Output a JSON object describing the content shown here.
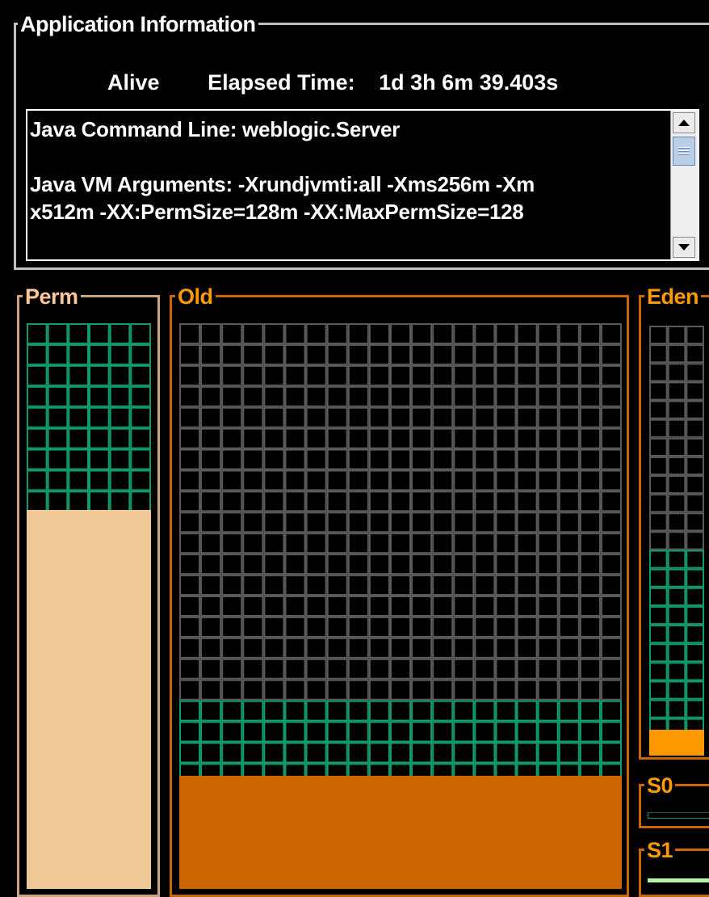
{
  "app_info": {
    "title": "Application Information",
    "status": "Alive",
    "elapsed_label": "Elapsed Time:",
    "elapsed_value": "1d 3h 6m 39.403s",
    "command_lines": [
      "Java Command Line: weblogic.Server",
      "",
      "Java VM Arguments: -Xrundjvmti:all -Xms256m -Xm",
      "x512m -XX:PermSize=128m -XX:MaxPermSize=128"
    ]
  },
  "generations": {
    "perm": {
      "label": "Perm",
      "used_fraction": 0.67
    },
    "old": {
      "label": "Old",
      "capacity_fraction": 0.35,
      "used_fraction": 0.2
    },
    "eden": {
      "label": "Eden",
      "capacity_fraction": 0.5,
      "used_fraction": 0.06
    },
    "s0": {
      "label": "S0"
    },
    "s1": {
      "label": "S1"
    }
  },
  "colors": {
    "used_perm": "#f0c796",
    "used_old": "#cc6600",
    "used_eden": "#ff9900",
    "grid_committed": "#0f9b6c",
    "grid_free": "#5a5a5a"
  }
}
